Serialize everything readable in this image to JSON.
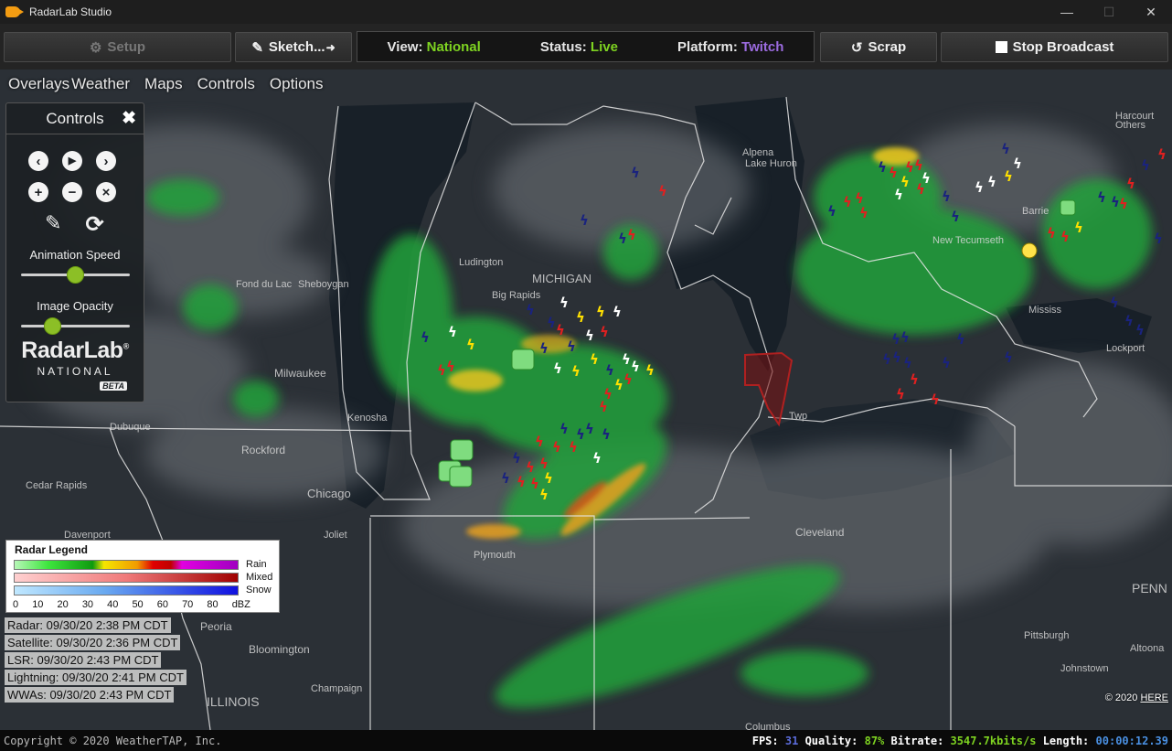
{
  "window": {
    "title": "RadarLab Studio",
    "min": "—",
    "max": "☐",
    "close": "✕"
  },
  "toolbar": {
    "setup_label": "Setup",
    "sketch_label": "Sketch...",
    "view_label": "View:",
    "view_value": "National",
    "status_label": "Status:",
    "status_value": "Live",
    "platform_label": "Platform:",
    "platform_value": "Twitch",
    "scrap_label": "Scrap",
    "stop_label": "Stop Broadcast",
    "colors": {
      "live": "#7ed321",
      "twitch": "#9b6bdf"
    }
  },
  "menu": [
    "Overlays",
    "Weather",
    "Maps",
    "Controls",
    "Options"
  ],
  "controls": {
    "title": "Controls",
    "animation_label": "Animation Speed",
    "animation_value": 0.5,
    "opacity_label": "Image Opacity",
    "opacity_value": 0.25,
    "logo_main": "RadarLab",
    "logo_reg": "®",
    "logo_sub": "NATIONAL",
    "logo_beta": "BETA",
    "icons": [
      "chevron-left-icon",
      "play-icon",
      "chevron-right-icon",
      "zoom-in-icon",
      "zoom-out-icon",
      "reset-icon",
      "pencil-icon",
      "refresh-icon"
    ]
  },
  "legend": {
    "title": "Radar Legend",
    "rows": [
      "Rain",
      "Mixed",
      "Snow"
    ],
    "ticks": [
      "0",
      "10",
      "20",
      "30",
      "40",
      "50",
      "60",
      "70",
      "80",
      "dBZ"
    ]
  },
  "stamps": [
    "Radar: 09/30/20 2:38 PM CDT",
    "Satellite: 09/30/20 2:36 PM CDT",
    "LSR: 09/30/20 2:43 PM CDT",
    "Lightning: 09/30/20 2:41 PM CDT",
    "WWAs: 09/30/20 2:43 PM CDT"
  ],
  "credit": {
    "prefix": "© 2020 ",
    "link": "HERE"
  },
  "map_labels": {
    "michigan": "MICHIGAN",
    "illinois": "ILLINOIS",
    "penn": "PENN",
    "lake_huron": "Lake Huron",
    "milwaukee": "Milwaukee",
    "chicago": "Chicago",
    "rockford": "Rockford",
    "peoria": "Peoria",
    "bloomington": "Bloomington",
    "cleveland": "Cleveland",
    "detroit": "Twp",
    "mississauga": "Mississ",
    "barrie": "Barrie",
    "pittsburgh": "Pittsburgh",
    "altoona": "Altoona",
    "dubuque": "Dubuque",
    "cedar_rapids": "Cedar Rapids",
    "davenport": "Davenport",
    "sheboygan": "Sheboygan",
    "big_rapids": "Big Rapids",
    "ludington": "Ludington",
    "plymouth": "Plymouth",
    "kenosha": "Kenosha",
    "fond_du_lac": "Fond du Lac",
    "joliet": "Joliet",
    "champaign": "Champaign",
    "columbus": "Columbus",
    "alpena": "Alpena",
    "new_tecumseth": "New Tecumseth",
    "lockport": "Lockport",
    "johnstown": "Johnstown",
    "others": "Others",
    "harcourt": "Harcourt"
  },
  "footer": {
    "copyright": "Copyright © 2020 WeatherTAP, Inc.",
    "fps_label": "FPS:",
    "fps_value": "31",
    "quality_label": "Quality:",
    "quality_value": "87%",
    "bitrate_label": "Bitrate:",
    "bitrate_value": "3547.7kbits/s",
    "length_label": "Length:",
    "length_value": "00:00:12.39"
  }
}
